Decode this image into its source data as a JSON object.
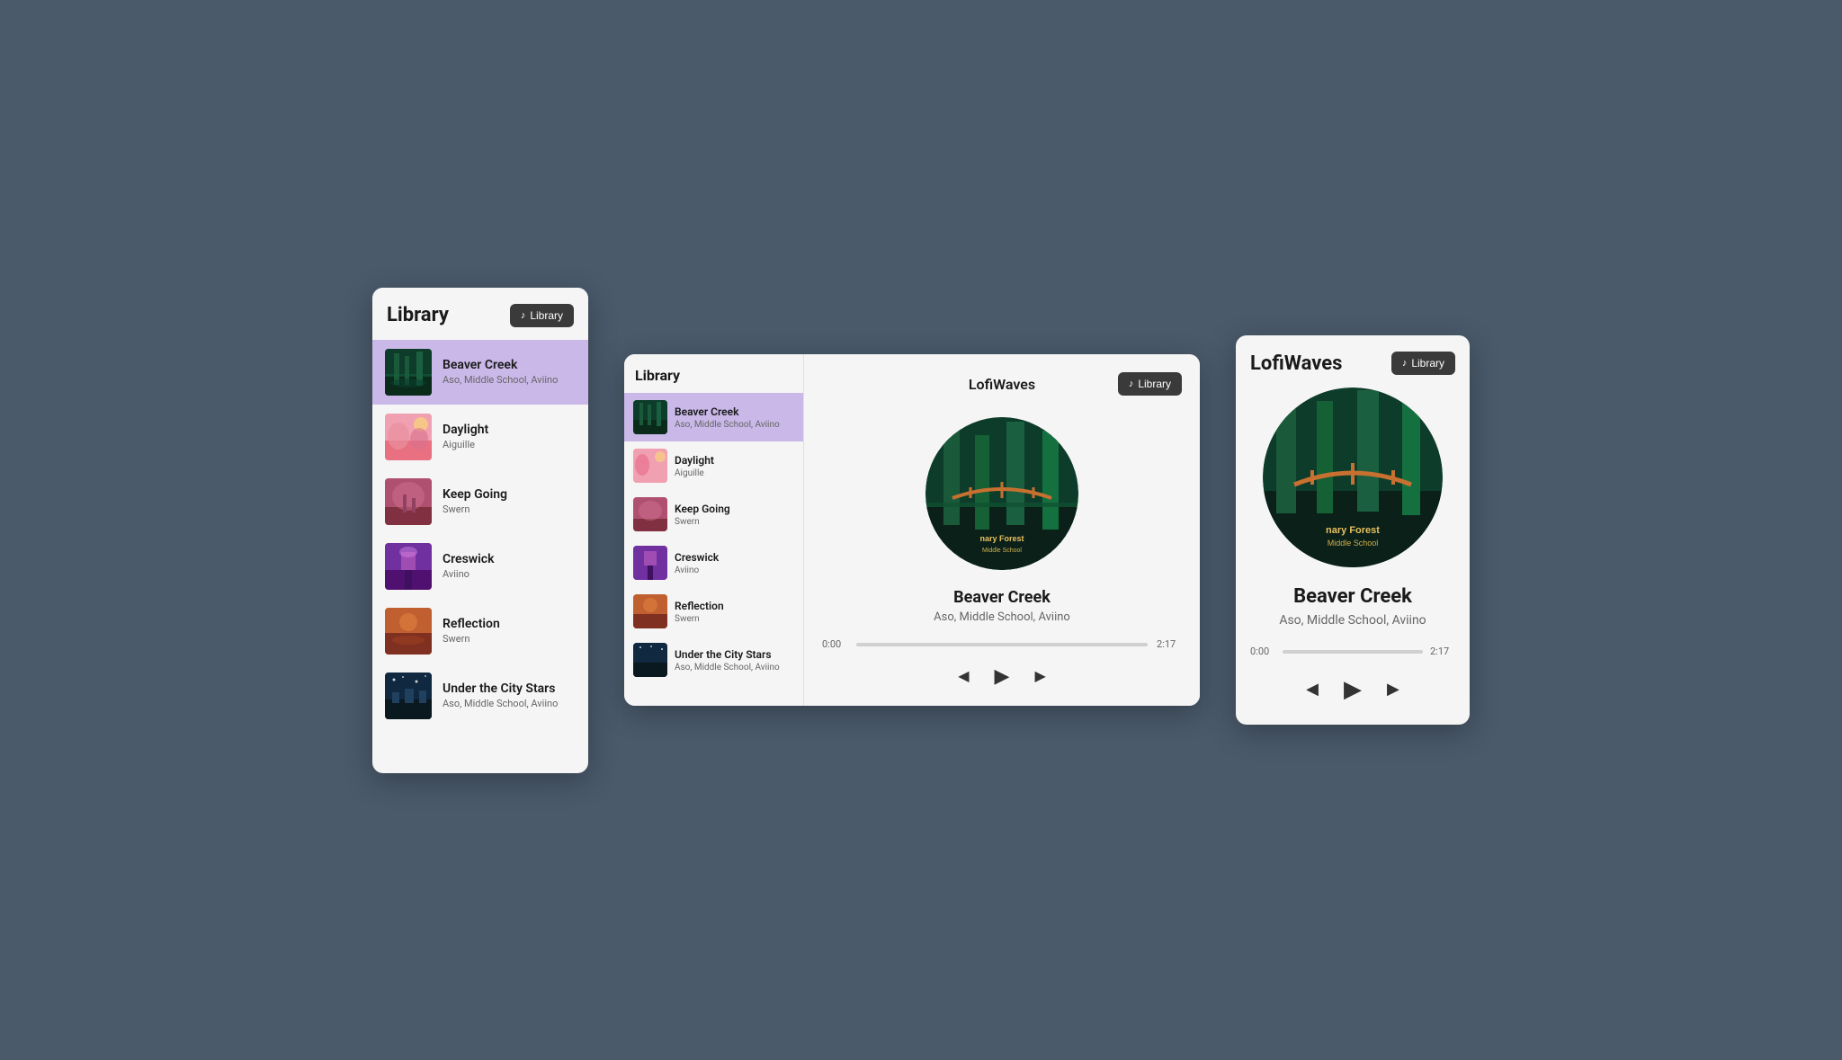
{
  "left_card": {
    "title": "Library",
    "library_btn": "Library",
    "tracks": [
      {
        "id": "beaver-creek",
        "name": "Beaver Creek",
        "artist": "Aso, Middle School, Aviino",
        "art": "beaver-creek",
        "active": true
      },
      {
        "id": "daylight",
        "name": "Daylight",
        "artist": "Aiguille",
        "art": "daylight",
        "active": false
      },
      {
        "id": "keep-going",
        "name": "Keep Going",
        "artist": "Swern",
        "art": "keep-going",
        "active": false
      },
      {
        "id": "creswick",
        "name": "Creswick",
        "artist": "Aviino",
        "art": "creswick",
        "active": false
      },
      {
        "id": "reflection",
        "name": "Reflection",
        "artist": "Swern",
        "art": "reflection",
        "active": false
      },
      {
        "id": "city-stars",
        "name": "Under the City Stars",
        "artist": "Aso, Middle School, Aviino",
        "art": "city-stars",
        "active": false
      }
    ]
  },
  "center_card": {
    "sidebar_title": "Library",
    "player_title": "LofiWaves",
    "library_btn": "Library",
    "tracks": [
      {
        "id": "beaver-creek",
        "name": "Beaver Creek",
        "artist": "Aso, Middle School, Aviino",
        "art": "beaver-creek",
        "active": true
      },
      {
        "id": "daylight",
        "name": "Daylight",
        "artist": "Aiguille",
        "art": "daylight",
        "active": false
      },
      {
        "id": "keep-going",
        "name": "Keep Going",
        "artist": "Swern",
        "art": "keep-going",
        "active": false
      },
      {
        "id": "creswick",
        "name": "Creswick",
        "artist": "Aviino",
        "art": "creswick",
        "active": false
      },
      {
        "id": "reflection",
        "name": "Reflection",
        "artist": "Swern",
        "art": "reflection",
        "active": false
      },
      {
        "id": "city-stars",
        "name": "Under the City Stars",
        "artist": "Aso, Middle School, Aviino",
        "art": "city-stars",
        "active": false
      }
    ],
    "now_playing": {
      "name": "Beaver Creek",
      "artist": "Aso, Middle School, Aviino",
      "current_time": "0:00",
      "total_time": "2:17",
      "progress_pct": 0
    }
  },
  "right_card": {
    "title": "LofiWaves",
    "library_btn": "Library",
    "track_name": "Beaver Creek",
    "track_artist": "Aso, Middle School, Aviino",
    "current_time": "0:00",
    "total_time": "2:17",
    "progress_pct": 0
  }
}
